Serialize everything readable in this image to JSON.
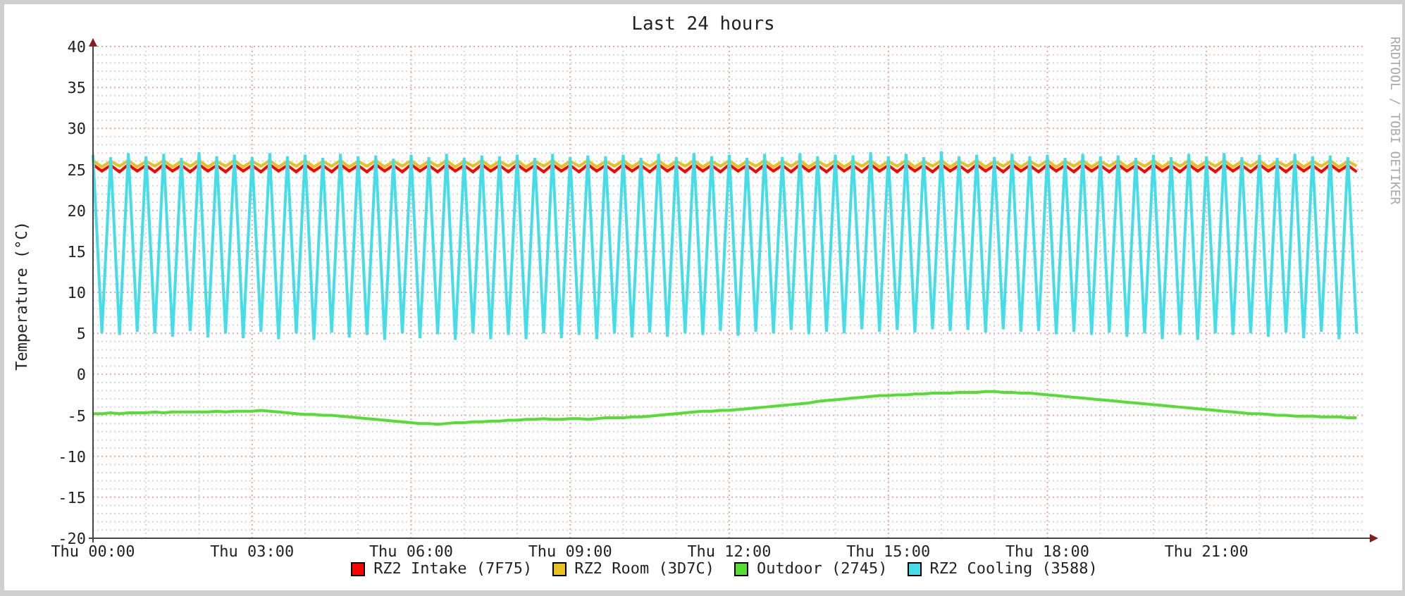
{
  "credit": "RRDTOOL / TOBI OETIKER",
  "chart_data": {
    "type": "line",
    "title": "Last 24 hours",
    "ylabel": "Temperature (°C)",
    "ylim": [
      -20,
      40
    ],
    "grid": true,
    "yticks": [
      -20,
      -15,
      -10,
      -5,
      0,
      5,
      10,
      15,
      20,
      25,
      30,
      35,
      40
    ],
    "categories": [
      "Thu 00:00",
      null,
      null,
      null,
      null,
      null,
      null,
      null,
      null,
      null,
      null,
      null,
      null,
      null,
      null,
      null,
      null,
      null,
      "Thu 03:00",
      null,
      null,
      null,
      null,
      null,
      null,
      null,
      null,
      null,
      null,
      null,
      null,
      null,
      null,
      null,
      null,
      null,
      "Thu 06:00",
      null,
      null,
      null,
      null,
      null,
      null,
      null,
      null,
      null,
      null,
      null,
      null,
      null,
      null,
      null,
      null,
      null,
      "Thu 09:00",
      null,
      null,
      null,
      null,
      null,
      null,
      null,
      null,
      null,
      null,
      null,
      null,
      null,
      null,
      null,
      null,
      null,
      "Thu 12:00",
      null,
      null,
      null,
      null,
      null,
      null,
      null,
      null,
      null,
      null,
      null,
      null,
      null,
      null,
      null,
      null,
      null,
      "Thu 15:00",
      null,
      null,
      null,
      null,
      null,
      null,
      null,
      null,
      null,
      null,
      null,
      null,
      null,
      null,
      null,
      null,
      null,
      "Thu 18:00",
      null,
      null,
      null,
      null,
      null,
      null,
      null,
      null,
      null,
      null,
      null,
      null,
      null,
      null,
      null,
      null,
      null,
      "Thu 21:00",
      null,
      null,
      null,
      null,
      null,
      null,
      null,
      null,
      null,
      null,
      null,
      null,
      null,
      null,
      null,
      null,
      null
    ],
    "series": [
      {
        "name": "RZ2 Intake (7F75)",
        "color": "#ff0000",
        "values": [
          25.6,
          24.8,
          25.5,
          24.7,
          25.6,
          24.8,
          25.5,
          24.7,
          25.6,
          24.8,
          25.5,
          24.7,
          25.6,
          24.8,
          25.5,
          24.7,
          25.6,
          24.8,
          25.5,
          24.7,
          25.6,
          24.8,
          25.5,
          24.7,
          25.6,
          24.8,
          25.5,
          24.7,
          25.6,
          24.8,
          25.5,
          24.7,
          25.6,
          24.8,
          25.5,
          24.7,
          25.6,
          24.8,
          25.5,
          24.7,
          25.6,
          24.8,
          25.5,
          24.7,
          25.6,
          24.8,
          25.5,
          24.7,
          25.6,
          24.8,
          25.5,
          24.7,
          25.6,
          24.8,
          25.5,
          24.7,
          25.6,
          24.8,
          25.5,
          24.7,
          25.6,
          24.8,
          25.5,
          24.7,
          25.6,
          24.8,
          25.5,
          24.7,
          25.6,
          24.8,
          25.5,
          24.7,
          25.6,
          24.8,
          25.5,
          24.7,
          25.6,
          24.8,
          25.5,
          24.7,
          25.6,
          24.8,
          25.5,
          24.7,
          25.6,
          24.8,
          25.5,
          24.7,
          25.6,
          24.8,
          25.5,
          24.7,
          25.6,
          24.8,
          25.5,
          24.7,
          25.6,
          24.8,
          25.5,
          24.7,
          25.6,
          24.8,
          25.5,
          24.7,
          25.6,
          24.8,
          25.5,
          24.7,
          25.6,
          24.8,
          25.5,
          24.7,
          25.6,
          24.8,
          25.5,
          24.7,
          25.6,
          24.8,
          25.5,
          24.7,
          25.6,
          24.8,
          25.5,
          24.7,
          25.6,
          24.8,
          25.5,
          24.7,
          25.6,
          24.8,
          25.5,
          24.7,
          25.6,
          24.8,
          25.5,
          24.7,
          25.6,
          24.8,
          25.5,
          24.7,
          25.6,
          24.8,
          25.5,
          24.7
        ]
      },
      {
        "name": "RZ2 Room (3D7C)",
        "color": "#e8c020",
        "values": [
          26.1,
          25.3,
          26.0,
          25.4,
          26.1,
          25.3,
          26.0,
          25.4,
          26.1,
          25.3,
          26.0,
          25.4,
          26.1,
          25.3,
          26.0,
          25.4,
          26.1,
          25.3,
          26.0,
          25.4,
          26.1,
          25.3,
          26.0,
          25.4,
          26.1,
          25.3,
          26.0,
          25.4,
          26.1,
          25.3,
          26.0,
          25.4,
          26.1,
          25.3,
          26.0,
          25.4,
          26.1,
          25.3,
          26.0,
          25.4,
          26.1,
          25.3,
          26.0,
          25.4,
          26.1,
          25.3,
          26.0,
          25.4,
          26.1,
          25.3,
          26.0,
          25.4,
          26.1,
          25.3,
          26.0,
          25.4,
          26.1,
          25.3,
          26.0,
          25.4,
          26.1,
          25.3,
          26.0,
          25.4,
          26.1,
          25.3,
          26.0,
          25.4,
          26.1,
          25.3,
          26.0,
          25.4,
          26.1,
          25.3,
          26.0,
          25.4,
          26.1,
          25.3,
          26.0,
          25.4,
          26.1,
          25.3,
          26.0,
          25.4,
          26.1,
          25.3,
          26.0,
          25.4,
          26.1,
          25.3,
          26.0,
          25.4,
          26.1,
          25.3,
          26.0,
          25.4,
          26.1,
          25.3,
          26.0,
          25.4,
          26.1,
          25.3,
          26.0,
          25.4,
          26.1,
          25.3,
          26.0,
          25.4,
          26.1,
          25.3,
          26.0,
          25.4,
          26.1,
          25.3,
          26.0,
          25.4,
          26.1,
          25.3,
          26.0,
          25.4,
          26.1,
          25.3,
          26.0,
          25.4,
          26.1,
          25.3,
          26.0,
          25.4,
          26.1,
          25.3,
          26.0,
          25.4,
          26.1,
          25.3,
          26.0,
          25.4,
          26.1,
          25.3,
          26.0,
          25.4,
          26.1,
          25.3,
          26.0,
          25.4
        ]
      },
      {
        "name": "Outdoor (2745)",
        "color": "#55dd33",
        "values": [
          -4.8,
          -4.8,
          -4.7,
          -4.8,
          -4.7,
          -4.7,
          -4.7,
          -4.6,
          -4.7,
          -4.6,
          -4.6,
          -4.6,
          -4.6,
          -4.6,
          -4.5,
          -4.6,
          -4.5,
          -4.5,
          -4.5,
          -4.4,
          -4.5,
          -4.6,
          -4.7,
          -4.8,
          -4.9,
          -4.9,
          -5.0,
          -5.0,
          -5.1,
          -5.2,
          -5.3,
          -5.4,
          -5.5,
          -5.6,
          -5.7,
          -5.8,
          -5.9,
          -6.0,
          -6.0,
          -6.1,
          -6.0,
          -5.9,
          -5.9,
          -5.8,
          -5.8,
          -5.7,
          -5.7,
          -5.6,
          -5.6,
          -5.5,
          -5.5,
          -5.4,
          -5.5,
          -5.5,
          -5.4,
          -5.4,
          -5.5,
          -5.4,
          -5.3,
          -5.3,
          -5.3,
          -5.2,
          -5.2,
          -5.1,
          -5.0,
          -4.9,
          -4.8,
          -4.7,
          -4.6,
          -4.5,
          -4.5,
          -4.4,
          -4.4,
          -4.3,
          -4.2,
          -4.1,
          -4.0,
          -3.9,
          -3.8,
          -3.7,
          -3.6,
          -3.5,
          -3.3,
          -3.2,
          -3.1,
          -3.0,
          -2.9,
          -2.8,
          -2.7,
          -2.6,
          -2.6,
          -2.5,
          -2.5,
          -2.4,
          -2.4,
          -2.3,
          -2.3,
          -2.3,
          -2.2,
          -2.2,
          -2.2,
          -2.1,
          -2.1,
          -2.2,
          -2.2,
          -2.3,
          -2.3,
          -2.4,
          -2.5,
          -2.6,
          -2.7,
          -2.8,
          -2.9,
          -3.0,
          -3.1,
          -3.2,
          -3.3,
          -3.4,
          -3.5,
          -3.6,
          -3.7,
          -3.8,
          -3.9,
          -4.0,
          -4.1,
          -4.2,
          -4.3,
          -4.4,
          -4.5,
          -4.6,
          -4.7,
          -4.8,
          -4.8,
          -4.9,
          -5.0,
          -5.0,
          -5.1,
          -5.1,
          -5.1,
          -5.2,
          -5.2,
          -5.2,
          -5.3,
          -5.3
        ]
      },
      {
        "name": "RZ2 Cooling (3588)",
        "color": "#44dde8",
        "values": [
          26.8,
          5,
          26.5,
          4.8,
          27,
          5.2,
          26.6,
          5,
          26.9,
          4.6,
          26.4,
          5.3,
          27.1,
          4.5,
          26.6,
          5,
          26.8,
          4.4,
          26.5,
          5.2,
          27,
          4.3,
          26.6,
          5,
          26.8,
          4.2,
          26.4,
          5.1,
          26.9,
          4.5,
          26.6,
          4.8,
          26.7,
          4.2,
          26.3,
          5,
          26.8,
          4.4,
          26.5,
          4.9,
          26.9,
          4.2,
          26.4,
          5,
          26.7,
          4.3,
          26.6,
          4.8,
          26.8,
          4.3,
          26.4,
          5,
          26.9,
          4.4,
          26.5,
          4.8,
          26.7,
          4.3,
          26.6,
          5,
          26.8,
          4.5,
          26.4,
          5.1,
          26.9,
          4.6,
          26.5,
          5,
          27,
          4.8,
          26.6,
          5.3,
          26.8,
          4.7,
          26.4,
          5.2,
          26.9,
          5,
          26.5,
          5.4,
          27,
          4.9,
          26.6,
          5.2,
          26.8,
          5,
          26.7,
          5.5,
          27.1,
          5.2,
          26.6,
          5.4,
          26.9,
          5.1,
          26.5,
          5.5,
          27.2,
          5.3,
          26.6,
          5.4,
          26.8,
          5.1,
          26.5,
          5.5,
          26.9,
          5.2,
          26.6,
          5.3,
          26.8,
          4.9,
          26.4,
          5.2,
          26.9,
          4.8,
          26.6,
          5.1,
          26.7,
          4.6,
          26.4,
          5,
          26.8,
          4.3,
          26.5,
          4.8,
          26.9,
          4.2,
          26.6,
          5,
          27,
          4.8,
          26.5,
          5,
          26.8,
          4.6,
          26.4,
          5.1,
          26.9,
          4.4,
          26.6,
          5.2,
          26.7,
          4.3,
          26.5,
          5
        ]
      }
    ]
  }
}
